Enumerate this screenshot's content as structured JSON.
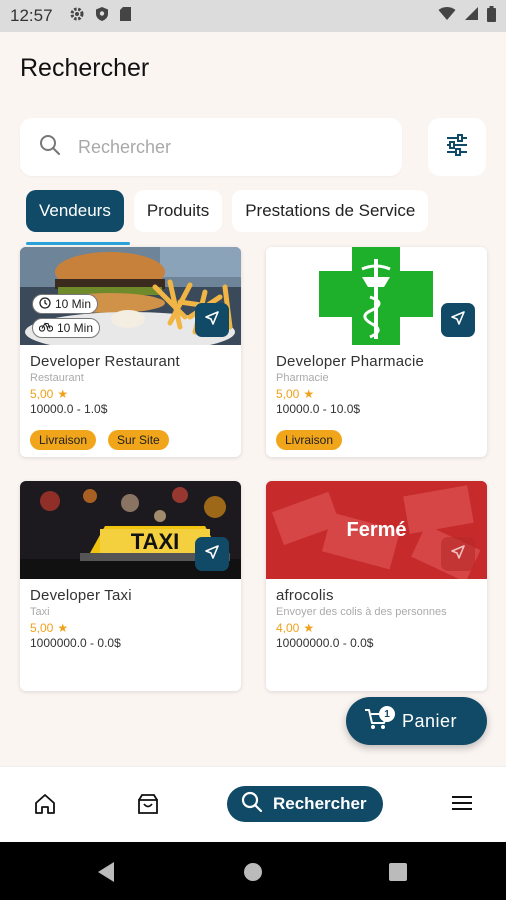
{
  "status_bar": {
    "time": "12:57"
  },
  "page": {
    "title": "Rechercher"
  },
  "search": {
    "placeholder": "Rechercher"
  },
  "tabs": [
    {
      "label": "Vendeurs",
      "active": true
    },
    {
      "label": "Produits",
      "active": false
    },
    {
      "label": "Prestations de Service",
      "active": false
    }
  ],
  "cards": [
    {
      "name": "Developer Restaurant",
      "category": "Restaurant",
      "rating": "5,00",
      "price": "10000.0 - 1.0$",
      "times": [
        "10 Min",
        "10 Min"
      ],
      "badges": [
        "Livraison",
        "Sur Site"
      ]
    },
    {
      "name": "Developer Pharmacie",
      "category": "Pharmacie",
      "rating": "5,00",
      "price": "10000.0 - 10.0$",
      "badges": [
        "Livraison"
      ]
    },
    {
      "name": "Developer Taxi",
      "category": "Taxi",
      "rating": "5,00",
      "price": "1000000.0 - 0.0$",
      "image_text": "TAXI"
    },
    {
      "name": "afrocolis",
      "category": "Envoyer des colis à des personnes",
      "rating": "4,00",
      "price": "10000000.0 - 0.0$",
      "overlay": "Fermé"
    }
  ],
  "cart": {
    "label": "Panier",
    "count": "1"
  },
  "bottom_nav": {
    "search_label": "Rechercher"
  },
  "colors": {
    "primary": "#104a66",
    "accent": "#f0a51a",
    "underline": "#2aa1d8",
    "pharmacy_green": "#1eb02a",
    "closed_red": "#c62a2a"
  },
  "icons": {
    "status": [
      "settings-icon",
      "shield-icon",
      "sd-card-icon",
      "wifi-icon",
      "signal-icon",
      "battery-icon"
    ],
    "bottom_nav": [
      "home-icon",
      "shop-icon",
      "search-icon",
      "menu-icon"
    ],
    "system_nav": [
      "back-icon",
      "home-circle-icon",
      "recents-icon"
    ]
  }
}
